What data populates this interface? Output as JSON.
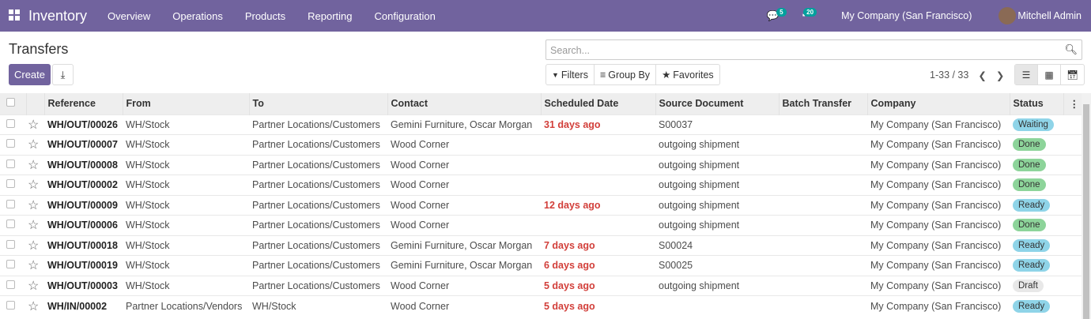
{
  "nav": {
    "app": "Inventory",
    "menus": [
      "Overview",
      "Operations",
      "Products",
      "Reporting",
      "Configuration"
    ],
    "messages_count": "5",
    "activities_count": "20",
    "company": "My Company (San Francisco)",
    "user": "Mitchell Admin"
  },
  "page": {
    "title": "Transfers",
    "create": "Create",
    "search_placeholder": "Search...",
    "filters": "Filters",
    "group_by": "Group By",
    "favorites": "Favorites",
    "pager": "1-33 / 33"
  },
  "columns": [
    "Reference",
    "From",
    "To",
    "Contact",
    "Scheduled Date",
    "Source Document",
    "Batch Transfer",
    "Company",
    "Status"
  ],
  "status_colors": {
    "Waiting": "#8fd4e8",
    "Done": "#8dd49a",
    "Ready": "#8fd4e8",
    "Draft": "#e8e8e8"
  },
  "rows": [
    {
      "ref": "WH/OUT/00026",
      "from": "WH/Stock",
      "to": "Partner Locations/Customers",
      "contact": "Gemini Furniture, Oscar Morgan",
      "date": "31 days ago",
      "source": "S00037",
      "batch": "",
      "company": "My Company (San Francisco)",
      "status": "Waiting"
    },
    {
      "ref": "WH/OUT/00007",
      "from": "WH/Stock",
      "to": "Partner Locations/Customers",
      "contact": "Wood Corner",
      "date": "",
      "source": "outgoing shipment",
      "batch": "",
      "company": "My Company (San Francisco)",
      "status": "Done"
    },
    {
      "ref": "WH/OUT/00008",
      "from": "WH/Stock",
      "to": "Partner Locations/Customers",
      "contact": "Wood Corner",
      "date": "",
      "source": "outgoing shipment",
      "batch": "",
      "company": "My Company (San Francisco)",
      "status": "Done"
    },
    {
      "ref": "WH/OUT/00002",
      "from": "WH/Stock",
      "to": "Partner Locations/Customers",
      "contact": "Wood Corner",
      "date": "",
      "source": "outgoing shipment",
      "batch": "",
      "company": "My Company (San Francisco)",
      "status": "Done"
    },
    {
      "ref": "WH/OUT/00009",
      "from": "WH/Stock",
      "to": "Partner Locations/Customers",
      "contact": "Wood Corner",
      "date": "12 days ago",
      "source": "outgoing shipment",
      "batch": "",
      "company": "My Company (San Francisco)",
      "status": "Ready"
    },
    {
      "ref": "WH/OUT/00006",
      "from": "WH/Stock",
      "to": "Partner Locations/Customers",
      "contact": "Wood Corner",
      "date": "",
      "source": "outgoing shipment",
      "batch": "",
      "company": "My Company (San Francisco)",
      "status": "Done"
    },
    {
      "ref": "WH/OUT/00018",
      "from": "WH/Stock",
      "to": "Partner Locations/Customers",
      "contact": "Gemini Furniture, Oscar Morgan",
      "date": "7 days ago",
      "source": "S00024",
      "batch": "",
      "company": "My Company (San Francisco)",
      "status": "Ready"
    },
    {
      "ref": "WH/OUT/00019",
      "from": "WH/Stock",
      "to": "Partner Locations/Customers",
      "contact": "Gemini Furniture, Oscar Morgan",
      "date": "6 days ago",
      "source": "S00025",
      "batch": "",
      "company": "My Company (San Francisco)",
      "status": "Ready"
    },
    {
      "ref": "WH/OUT/00003",
      "from": "WH/Stock",
      "to": "Partner Locations/Customers",
      "contact": "Wood Corner",
      "date": "5 days ago",
      "source": "outgoing shipment",
      "batch": "",
      "company": "My Company (San Francisco)",
      "status": "Draft"
    },
    {
      "ref": "WH/IN/00002",
      "from": "Partner Locations/Vendors",
      "to": "WH/Stock",
      "contact": "Wood Corner",
      "date": "5 days ago",
      "source": "",
      "batch": "",
      "company": "My Company (San Francisco)",
      "status": "Ready"
    }
  ]
}
